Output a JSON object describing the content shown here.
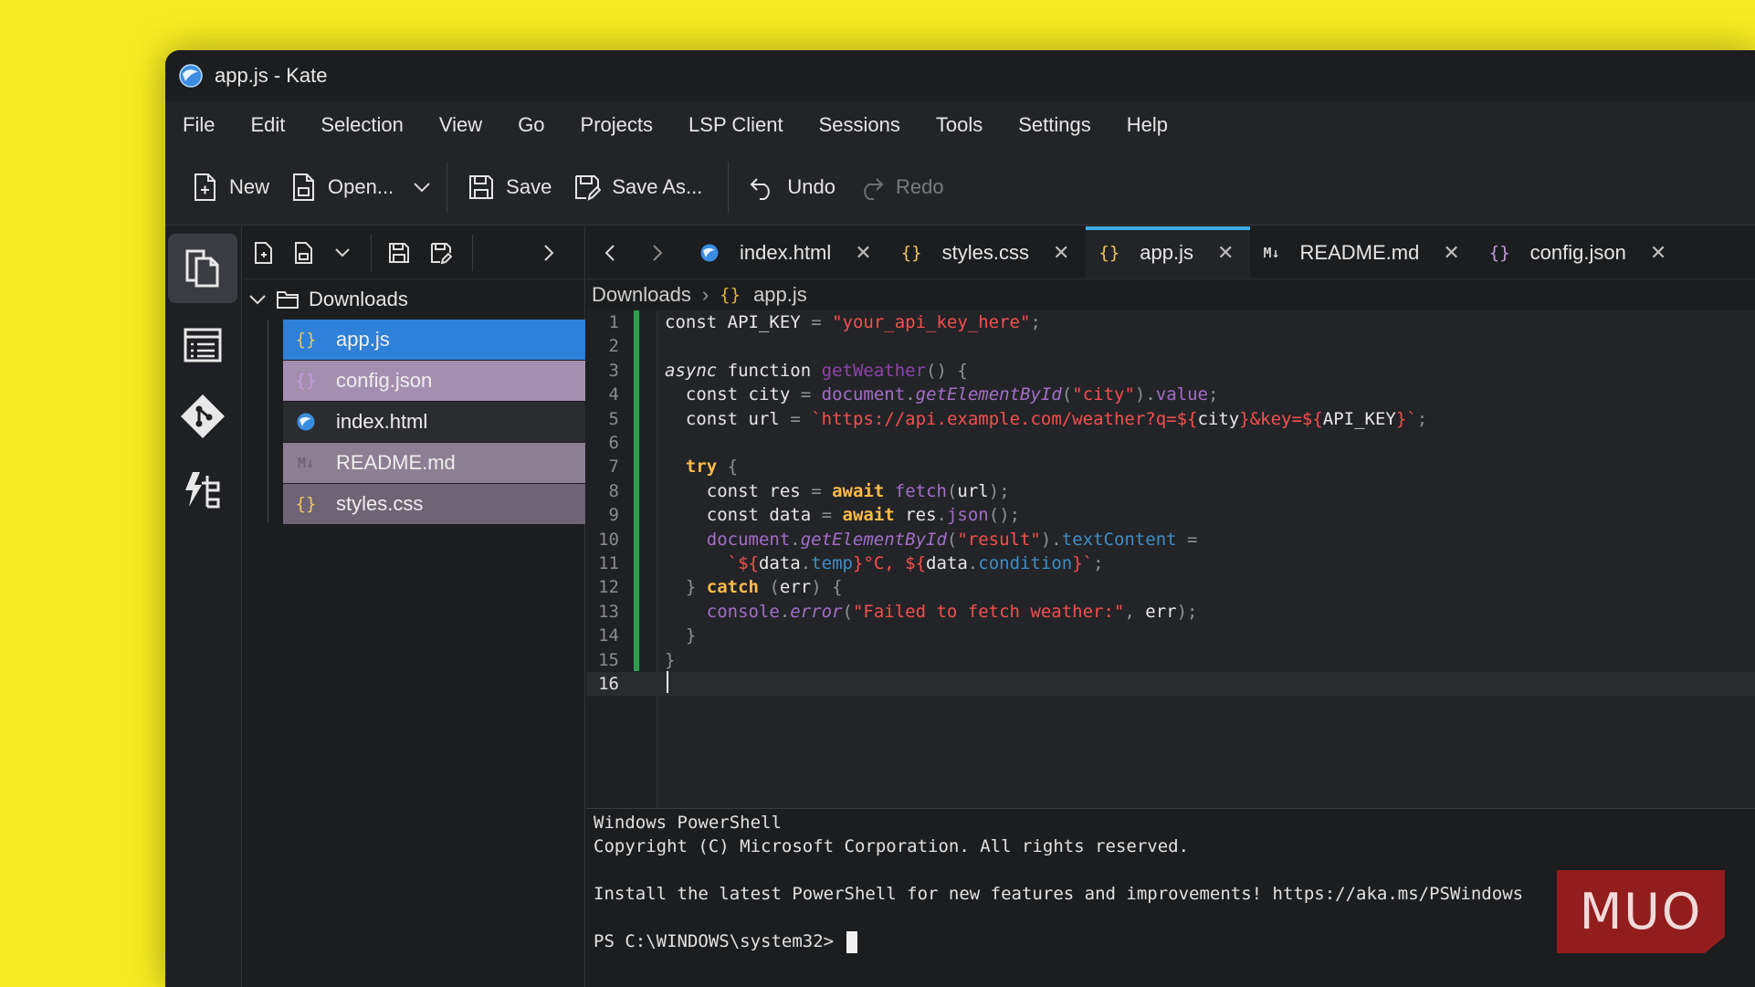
{
  "window": {
    "title": "app.js - Kate"
  },
  "menu": [
    "File",
    "Edit",
    "Selection",
    "View",
    "Go",
    "Projects",
    "LSP Client",
    "Sessions",
    "Tools",
    "Settings",
    "Help"
  ],
  "toolbar": {
    "new_label": "New",
    "open_label": "Open...",
    "save_label": "Save",
    "save_as_label": "Save As...",
    "undo_label": "Undo",
    "redo_label": "Redo"
  },
  "file_tree": {
    "root": "Downloads",
    "files": [
      {
        "name": "app.js",
        "icon": "{}",
        "state": "selected"
      },
      {
        "name": "config.json",
        "icon": "{}",
        "state": "open"
      },
      {
        "name": "index.html",
        "icon": "globe",
        "state": "normal"
      },
      {
        "name": "README.md",
        "icon": "M↓",
        "state": "open"
      },
      {
        "name": "styles.css",
        "icon": "{}",
        "state": "open"
      }
    ]
  },
  "tabs": [
    {
      "label": "index.html",
      "icon": "globe",
      "active": false
    },
    {
      "label": "styles.css",
      "icon": "{}",
      "active": false
    },
    {
      "label": "app.js",
      "icon": "{}",
      "active": true
    },
    {
      "label": "README.md",
      "icon": "M↓",
      "active": false
    },
    {
      "label": "config.json",
      "icon": "{}",
      "active": false
    }
  ],
  "breadcrumb": {
    "folder": "Downloads",
    "file": "app.js"
  },
  "editor": {
    "current_line": 16,
    "line_numbers": [
      "1",
      "2",
      "3",
      "4",
      "5",
      "6",
      "7",
      "8",
      "9",
      "10",
      "11",
      "12",
      "13",
      "14",
      "15",
      "16"
    ]
  },
  "terminal": {
    "lines": [
      "Windows PowerShell",
      "Copyright (C) Microsoft Corporation. All rights reserved.",
      "",
      "Install the latest PowerShell for new features and improvements! https://aka.ms/PSWindows",
      "",
      "PS C:\\WINDOWS\\system32> "
    ]
  },
  "watermark": "MUO",
  "colors": {
    "accent": "#3daee9",
    "selection": "#2f80d8",
    "open_file_highlight": "#a58fb0",
    "git_modified": "#2c9f4e",
    "background": "#f6ec22"
  }
}
